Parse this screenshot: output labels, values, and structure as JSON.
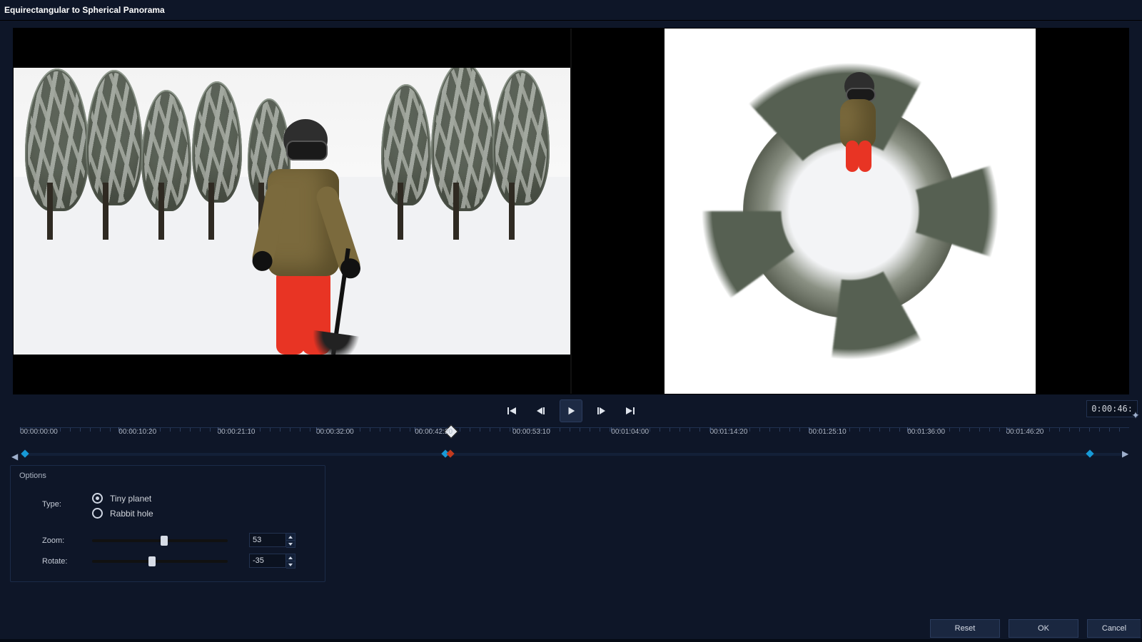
{
  "window": {
    "title": "Equirectangular to Spherical Panorama"
  },
  "transport": {
    "current_time": "0:00:46:"
  },
  "timeline": {
    "ticks": [
      {
        "label": "00:00:00:00",
        "pct": 0
      },
      {
        "label": "00:00:10:20",
        "pct": 8.9
      },
      {
        "label": "00:00:21:10",
        "pct": 17.8
      },
      {
        "label": "00:00:32:00",
        "pct": 26.7
      },
      {
        "label": "00:00:42:20",
        "pct": 35.6
      },
      {
        "label": "00:00:53:10",
        "pct": 44.4
      },
      {
        "label": "00:01:04:00",
        "pct": 53.3
      },
      {
        "label": "00:01:14:20",
        "pct": 62.2
      },
      {
        "label": "00:01:25:10",
        "pct": 71.1
      },
      {
        "label": "00:01:36:00",
        "pct": 80.0
      },
      {
        "label": "00:01:46:20",
        "pct": 88.9
      }
    ],
    "playhead_pct": 38.8,
    "keyframes": [
      {
        "pct": 0.3,
        "cls": ""
      },
      {
        "pct": 38.4,
        "cls": ""
      },
      {
        "pct": 38.9,
        "cls": "red"
      },
      {
        "pct": 96.8,
        "cls": ""
      }
    ]
  },
  "options": {
    "title": "Options",
    "type_label": "Type:",
    "radios": [
      {
        "key": "tiny_planet",
        "label": "Tiny planet",
        "selected": true
      },
      {
        "key": "rabbit_hole",
        "label": "Rabbit hole",
        "selected": false
      }
    ],
    "zoom_label": "Zoom:",
    "zoom_value": "53",
    "zoom_pct": 53,
    "rotate_label": "Rotate:",
    "rotate_value": "-35",
    "rotate_pct": 44
  },
  "footer": {
    "reset": "Reset",
    "ok": "OK",
    "cancel": "Cancel"
  }
}
